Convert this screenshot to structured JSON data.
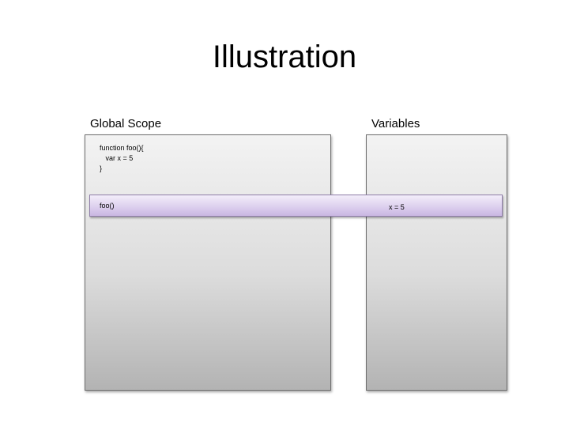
{
  "title": "Illustration",
  "panels": {
    "global_scope": {
      "label": "Global Scope",
      "code_lines": [
        "function foo(){",
        "   var x = 5",
        "}"
      ]
    },
    "variables": {
      "label": "Variables"
    }
  },
  "call_bar": {
    "call": "foo()",
    "variable": "x = 5"
  },
  "colors": {
    "panel_fill": "#dcdcdc",
    "call_bar_fill": "#ddd0ee"
  }
}
